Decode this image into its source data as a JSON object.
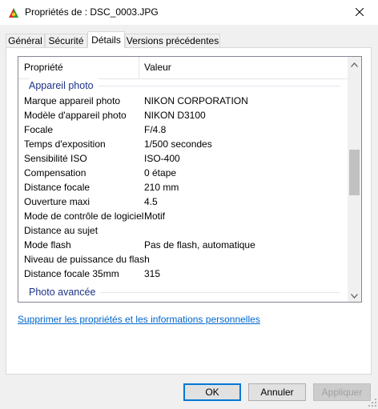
{
  "window": {
    "title": "Propriétés de : DSC_0003.JPG"
  },
  "tabs": [
    {
      "label": "Général"
    },
    {
      "label": "Sécurité"
    },
    {
      "label": "Détails"
    },
    {
      "label": "Versions précédentes"
    }
  ],
  "active_tab": "Détails",
  "list": {
    "header_property": "Propriété",
    "header_value": "Valeur",
    "group_camera": "Appareil photo",
    "group_advanced": "Photo avancée",
    "rows": [
      {
        "property": "Marque appareil photo",
        "value": "NIKON CORPORATION"
      },
      {
        "property": "Modèle d'appareil photo",
        "value": "NIKON D3100"
      },
      {
        "property": "Focale",
        "value": "F/4.8"
      },
      {
        "property": "Temps d'exposition",
        "value": "1/500 secondes"
      },
      {
        "property": "Sensibilité ISO",
        "value": "ISO-400"
      },
      {
        "property": "Compensation",
        "value": "0 étape"
      },
      {
        "property": "Distance focale",
        "value": "210 mm"
      },
      {
        "property": "Ouverture maxi",
        "value": "4.5"
      },
      {
        "property": "Mode de contrôle de logiciel",
        "value": "Motif"
      },
      {
        "property": "Distance au sujet",
        "value": ""
      },
      {
        "property": "Mode flash",
        "value": "Pas de flash, automatique"
      },
      {
        "property": "Niveau de puissance du flash",
        "value": ""
      },
      {
        "property": "Distance focale 35mm",
        "value": "315"
      }
    ]
  },
  "remove_link": "Supprimer les propriétés et les informations personnelles",
  "buttons": {
    "ok": "OK",
    "cancel": "Annuler",
    "apply": "Appliquer"
  },
  "icons": {
    "app": "photo-app-icon",
    "close": "close-icon",
    "scroll_up": "chevron-up-icon",
    "scroll_down": "chevron-down-icon"
  },
  "colors": {
    "group_header": "#1e3287",
    "link": "#0066cc",
    "default_button_border": "#0078d7"
  }
}
